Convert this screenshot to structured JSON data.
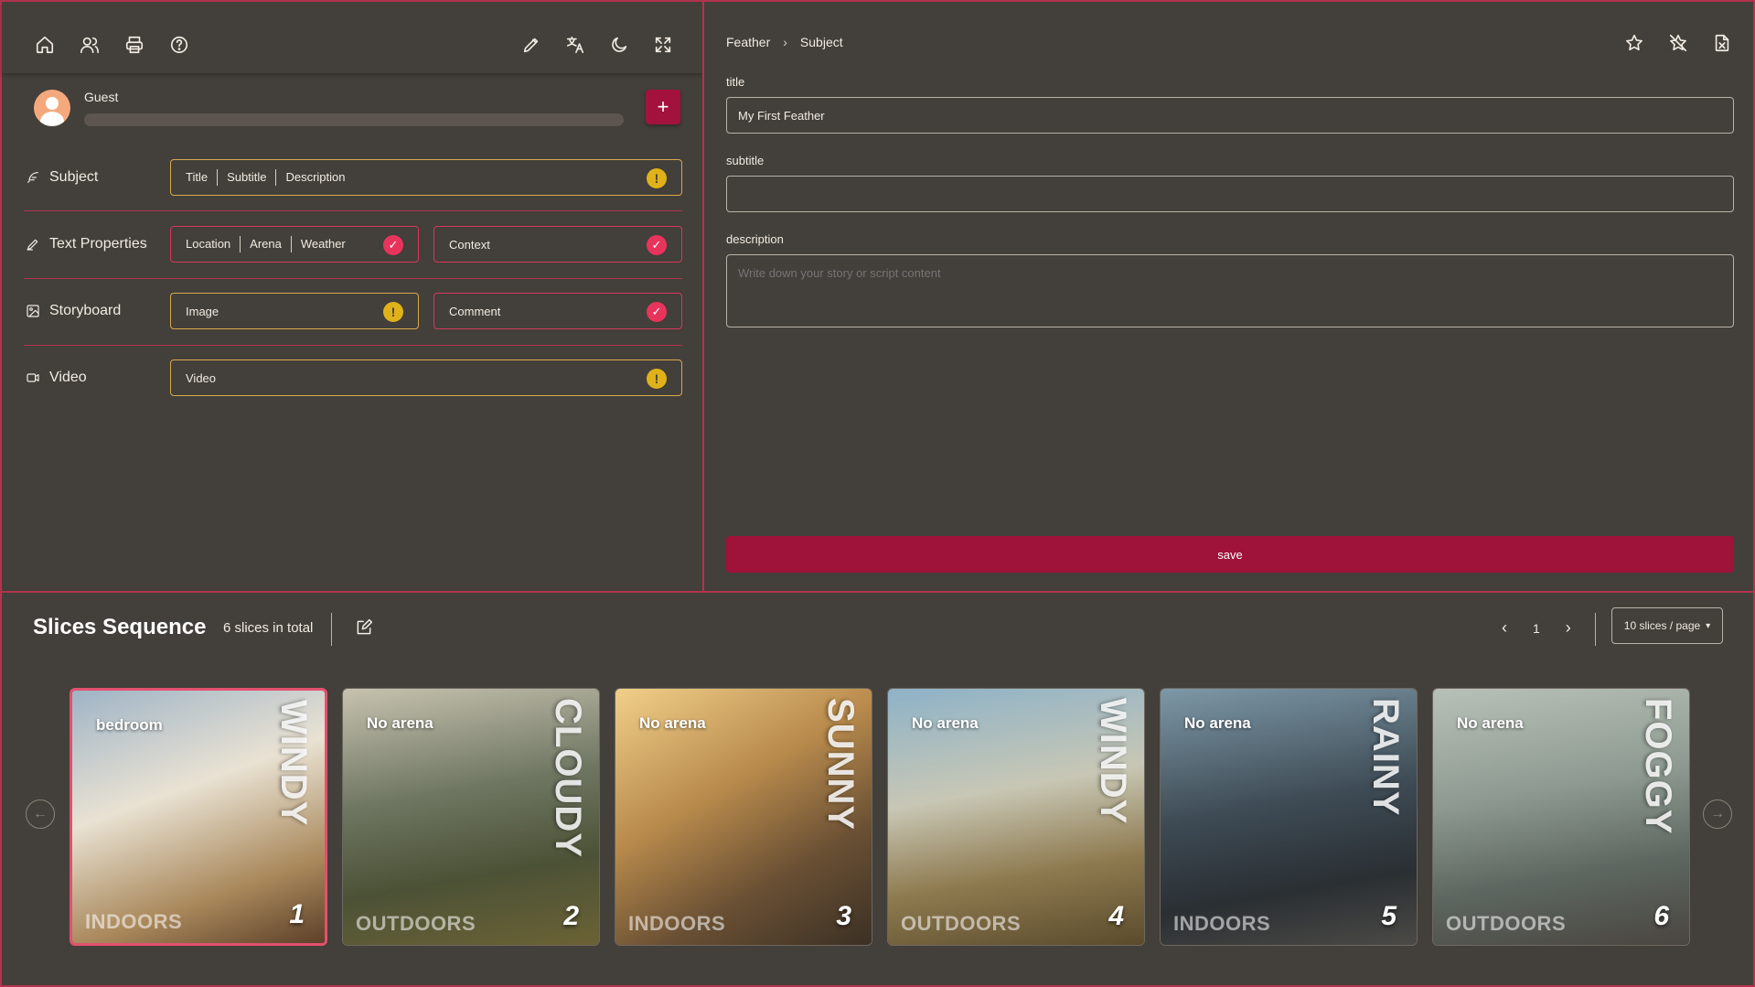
{
  "toolbar": {
    "left_icons": [
      "home-icon",
      "users-icon",
      "printer-icon",
      "help-icon"
    ],
    "right_icons": [
      "pencil-icon",
      "translate-icon",
      "moon-icon",
      "fullscreen-icon"
    ]
  },
  "user": {
    "name": "Guest",
    "progress": 0.0,
    "add_label": "+"
  },
  "rows": {
    "subject": {
      "label": "Subject",
      "segments": [
        "Title",
        "Subtitle",
        "Description"
      ],
      "status": "warning"
    },
    "text_properties": {
      "label": "Text Properties",
      "segments": [
        "Location",
        "Arena",
        "Weather"
      ],
      "status": "done",
      "context": {
        "label": "Context",
        "status": "done"
      }
    },
    "storyboard": {
      "label": "Storyboard",
      "image": {
        "label": "Image",
        "status": "warning"
      },
      "comment": {
        "label": "Comment",
        "status": "done"
      }
    },
    "video": {
      "label": "Video",
      "status": "warning"
    }
  },
  "breadcrumb": {
    "root": "Feather",
    "current": "Subject"
  },
  "form": {
    "title_label": "title",
    "title_value": "My First Feather",
    "subtitle_label": "subtitle",
    "subtitle_value": "",
    "description_label": "description",
    "description_placeholder": "Write down your story or script content",
    "save_label": "save"
  },
  "sequence": {
    "title": "Slices Sequence",
    "total": "6 slices in total",
    "page": "1",
    "page_size": "10 slices / page",
    "slices": [
      {
        "index": "1",
        "arena": "bedroom",
        "weather": "WINDY",
        "place": "INDOORS",
        "active": true
      },
      {
        "index": "2",
        "arena": "No arena",
        "weather": "CLOUDY",
        "place": "OUTDOORS",
        "active": false
      },
      {
        "index": "3",
        "arena": "No arena",
        "weather": "SUNNY",
        "place": "INDOORS",
        "active": false
      },
      {
        "index": "4",
        "arena": "No arena",
        "weather": "WINDY",
        "place": "OUTDOORS",
        "active": false
      },
      {
        "index": "5",
        "arena": "No arena",
        "weather": "RAINY",
        "place": "INDOORS",
        "active": false
      },
      {
        "index": "6",
        "arena": "No arena",
        "weather": "FOGGY",
        "place": "OUTDOORS",
        "active": false
      }
    ]
  },
  "colors": {
    "background": "#433f3a",
    "accent": "#a3123c",
    "border_accent": "#b3334f",
    "warning": "#e0b21a",
    "done": "#e8345c"
  }
}
